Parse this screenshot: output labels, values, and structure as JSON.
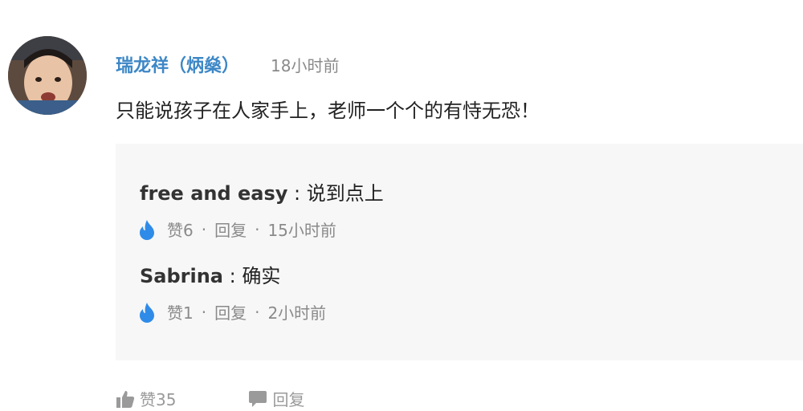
{
  "comment": {
    "username": "瑞龙祥（炳燊）",
    "timestamp": "18小时前",
    "text": "只能说孩子在人家手上，老师一个个的有恃无恐！",
    "like_label": "赞35",
    "reply_label": "回复"
  },
  "replies": [
    {
      "name": "free and easy",
      "separator": " : ",
      "text": "说到点上",
      "like_label": "赞6",
      "reply_label": "回复",
      "time": "15小时前"
    },
    {
      "name": "Sabrina",
      "separator": " : ",
      "text": "确实",
      "like_label": "赞1",
      "reply_label": "回复",
      "time": "2小时前"
    }
  ],
  "dot": "·",
  "colors": {
    "username": "#3d87c6",
    "flame": "#2f8be8",
    "reply_bg": "#f7f7f7",
    "meta": "#8a8a8a"
  },
  "icons": {
    "like": "thumbs-up-icon",
    "reply": "speech-bubble-icon",
    "reply_like": "flame-icon"
  }
}
